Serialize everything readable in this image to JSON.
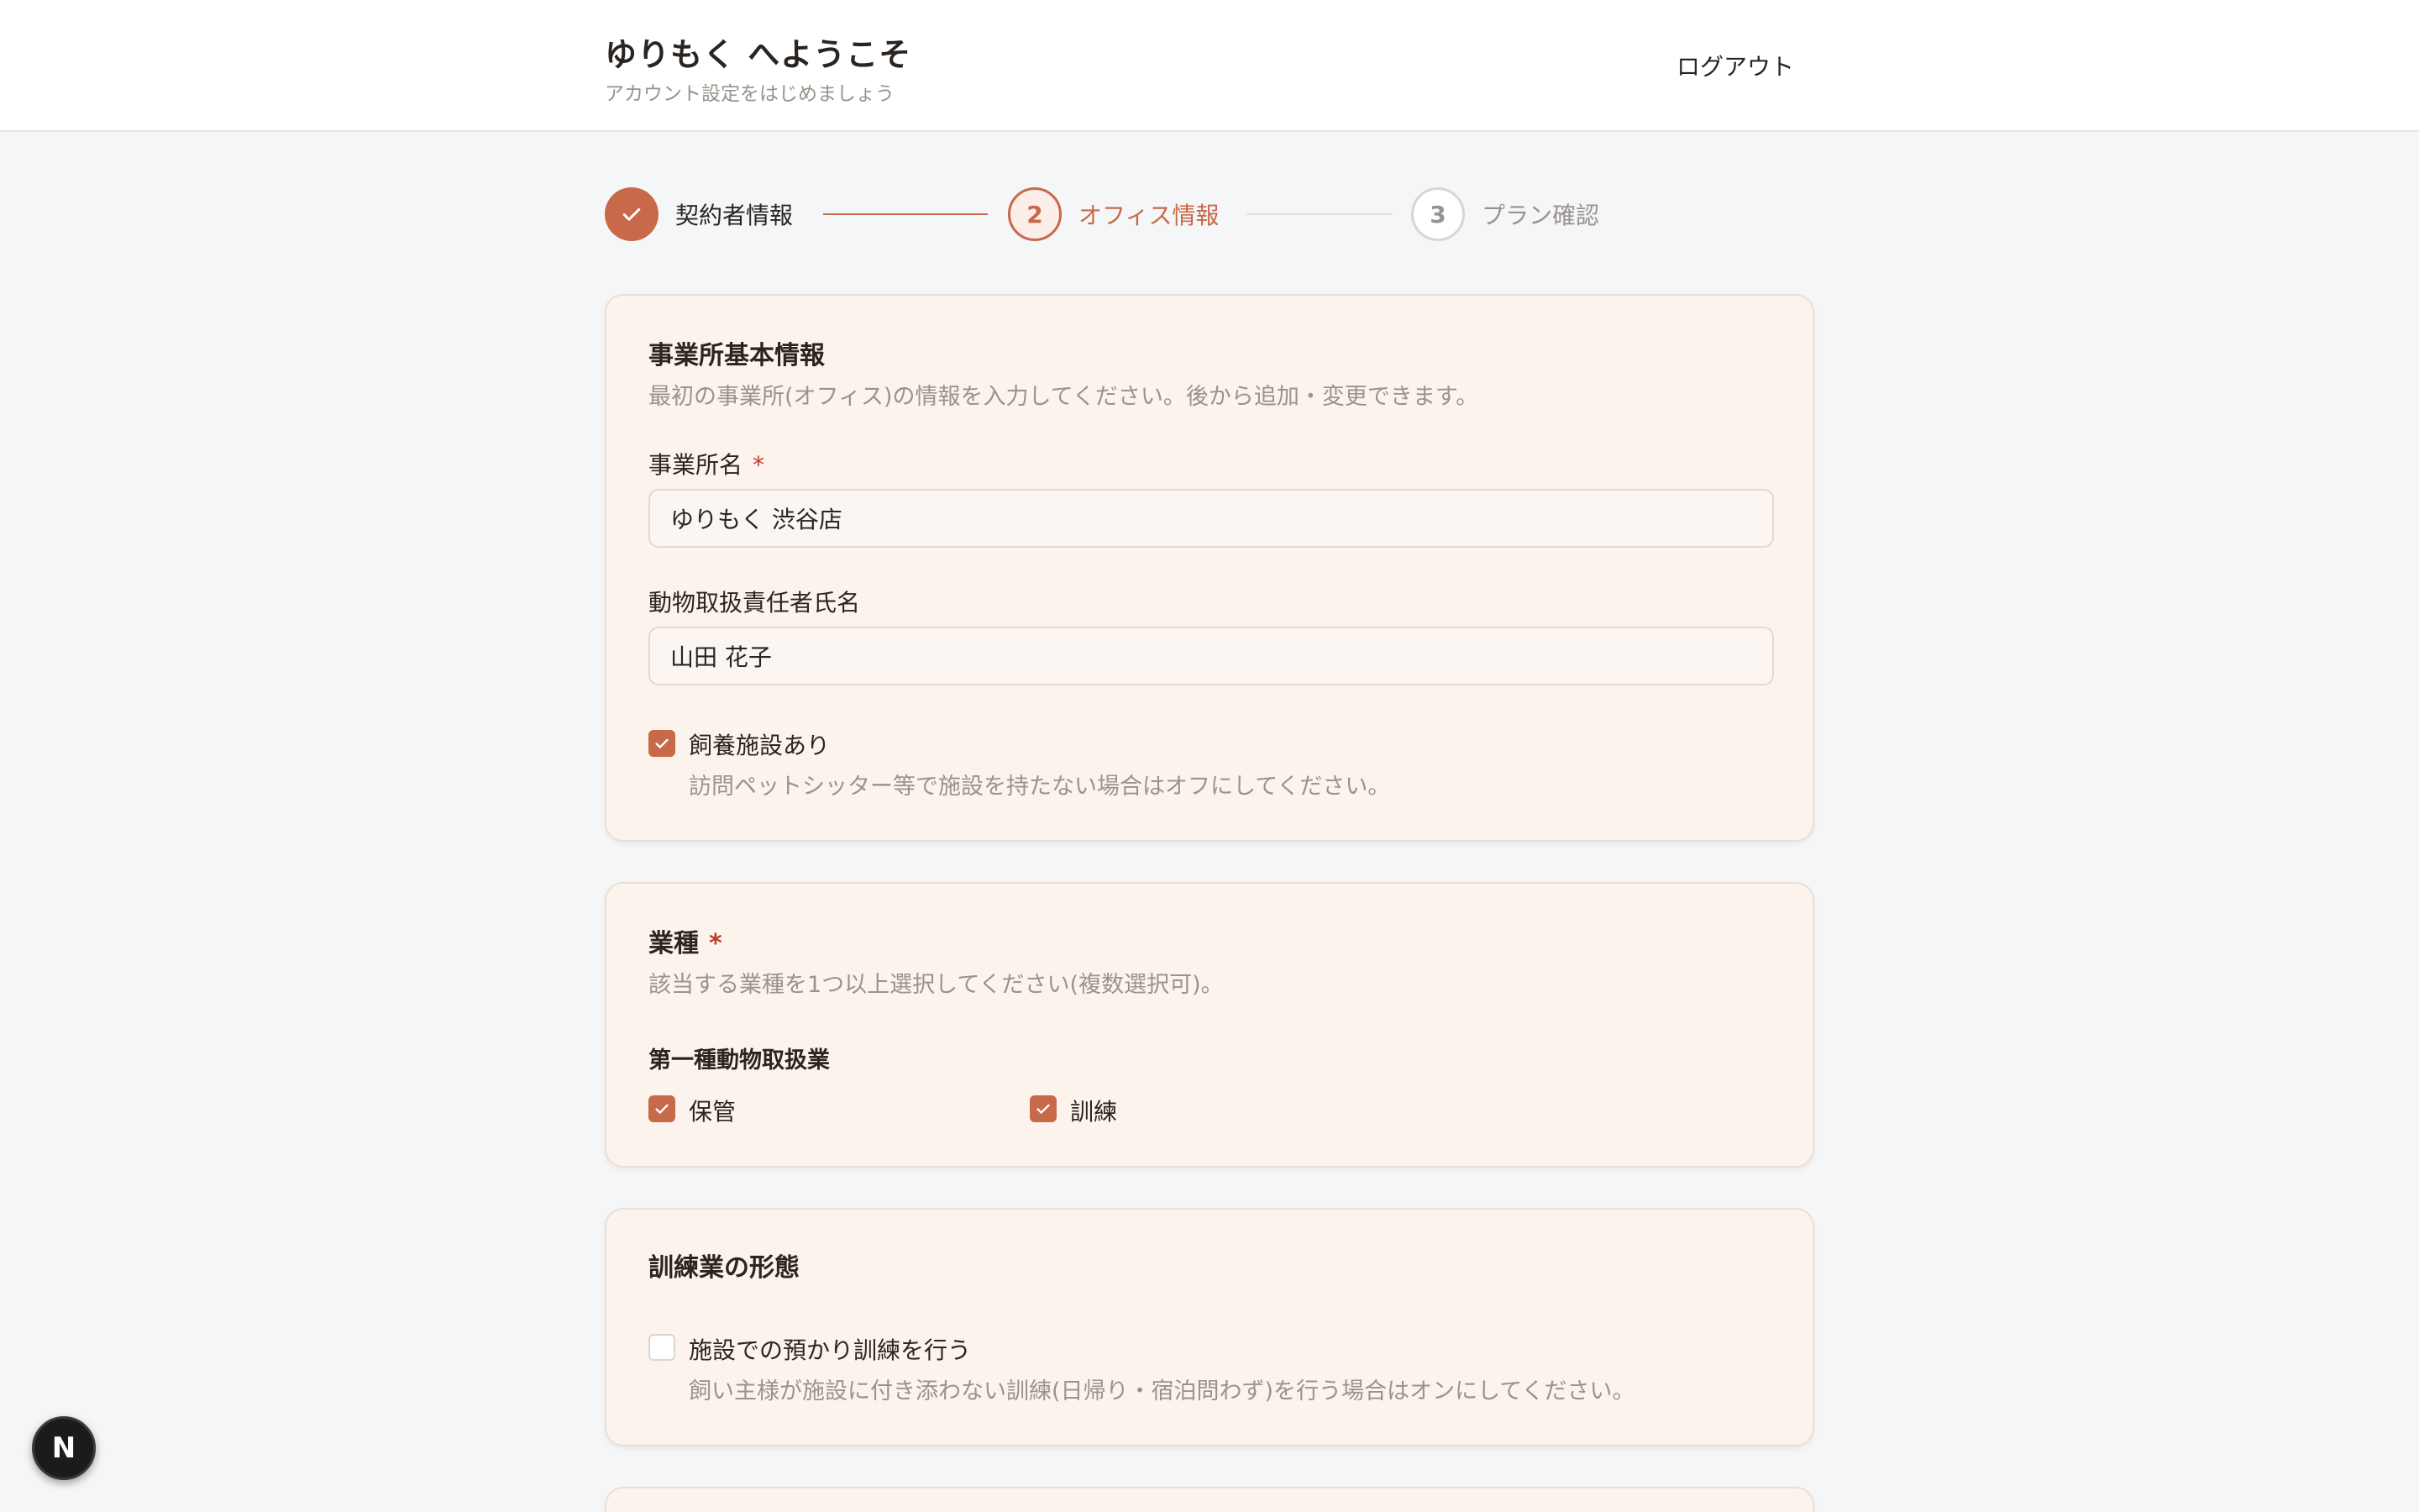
{
  "header": {
    "title": "ゆりもく へようこそ",
    "subtitle": "アカウント設定をはじめましょう",
    "logout_label": "ログアウト"
  },
  "stepper": {
    "steps": [
      {
        "number": "1",
        "label": "契約者情報",
        "state": "done"
      },
      {
        "number": "2",
        "label": "オフィス情報",
        "state": "active"
      },
      {
        "number": "3",
        "label": "プラン確認",
        "state": "todo"
      }
    ]
  },
  "office_card": {
    "title": "事業所基本情報",
    "description": "最初の事業所(オフィス)の情報を入力してください。後から追加・変更できます。",
    "office_name_label": "事業所名",
    "required_mark": "*",
    "office_name_value": "ゆりもく 渋谷店",
    "manager_label": "動物取扱責任者氏名",
    "manager_value": "山田 花子",
    "facility_checkbox_label": "飼養施設あり",
    "facility_checked": true,
    "facility_hint": "訪問ペットシッター等で施設を持たない場合はオフにしてください。"
  },
  "business_card": {
    "title": "業種",
    "required_mark": "*",
    "description": "該当する業種を1つ以上選択してください(複数選択可)。",
    "group_title": "第一種動物取扱業",
    "options": [
      {
        "label": "保管",
        "checked": true
      },
      {
        "label": "訓練",
        "checked": true
      }
    ]
  },
  "training_card": {
    "title": "訓練業の形態",
    "option_label": "施設での預かり訓練を行う",
    "option_checked": false,
    "option_hint": "飼い主様が施設に付き添わない訓練(日帰り・宿泊問わず)を行う場合はオンにしてください。"
  },
  "badge": {
    "letter": "N"
  },
  "colors": {
    "accent": "#c8694a",
    "card_background": "#fcf4ec",
    "page_background": "#f4f6f8"
  }
}
